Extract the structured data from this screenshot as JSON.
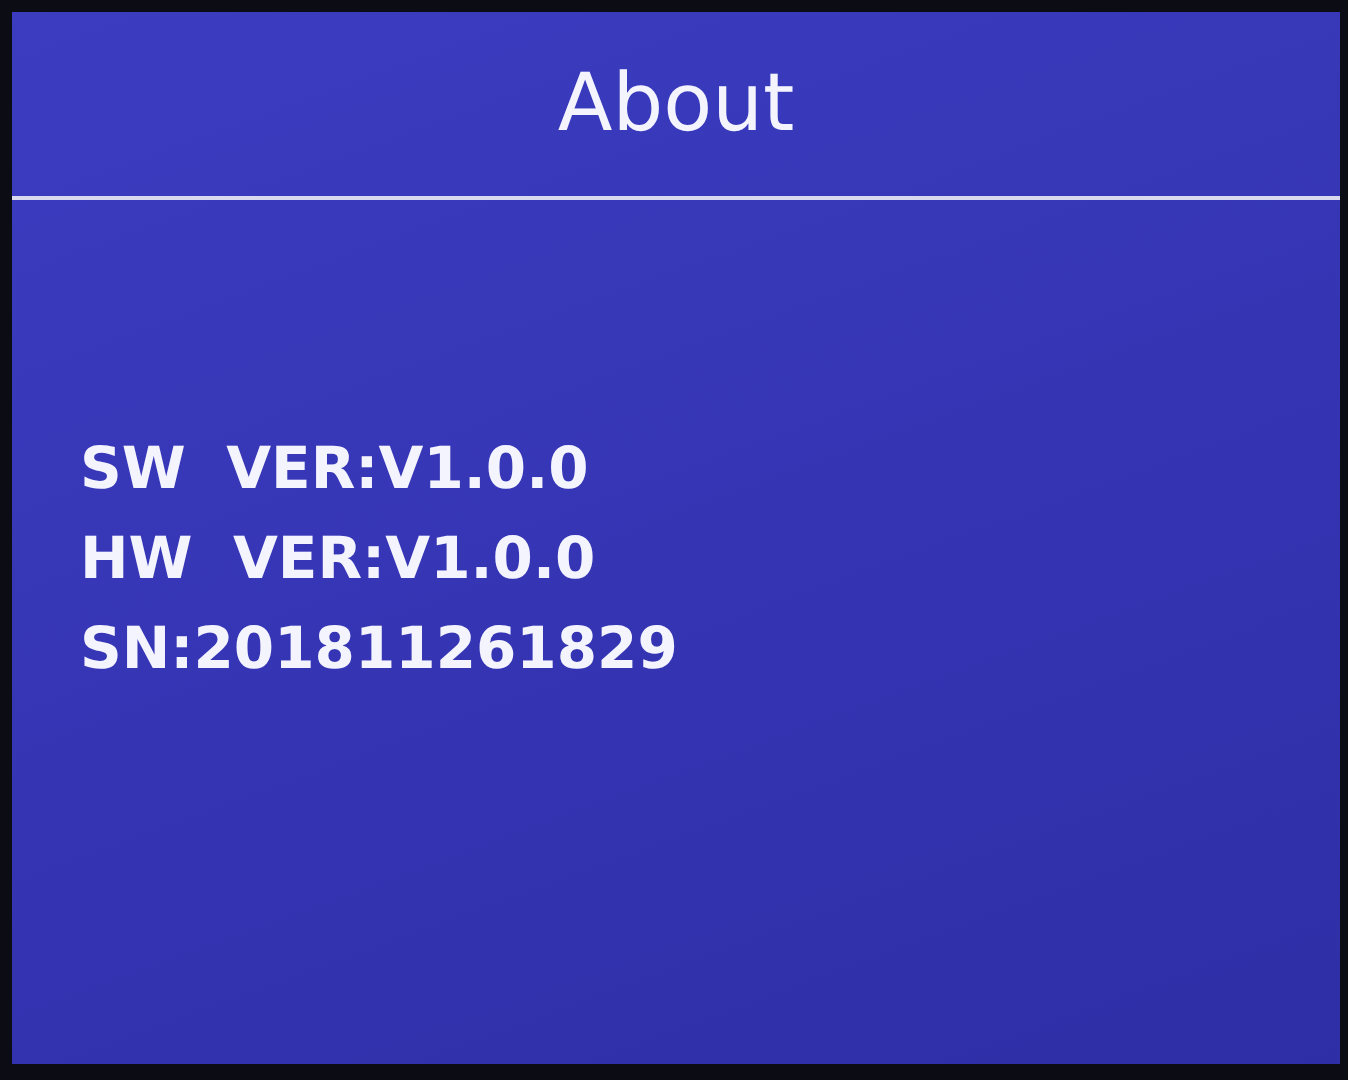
{
  "screen": {
    "title": "About",
    "lines": [
      "SW  VER:V1.0.0",
      "HW  VER:V1.0.0",
      "SN:201811261829"
    ]
  }
}
